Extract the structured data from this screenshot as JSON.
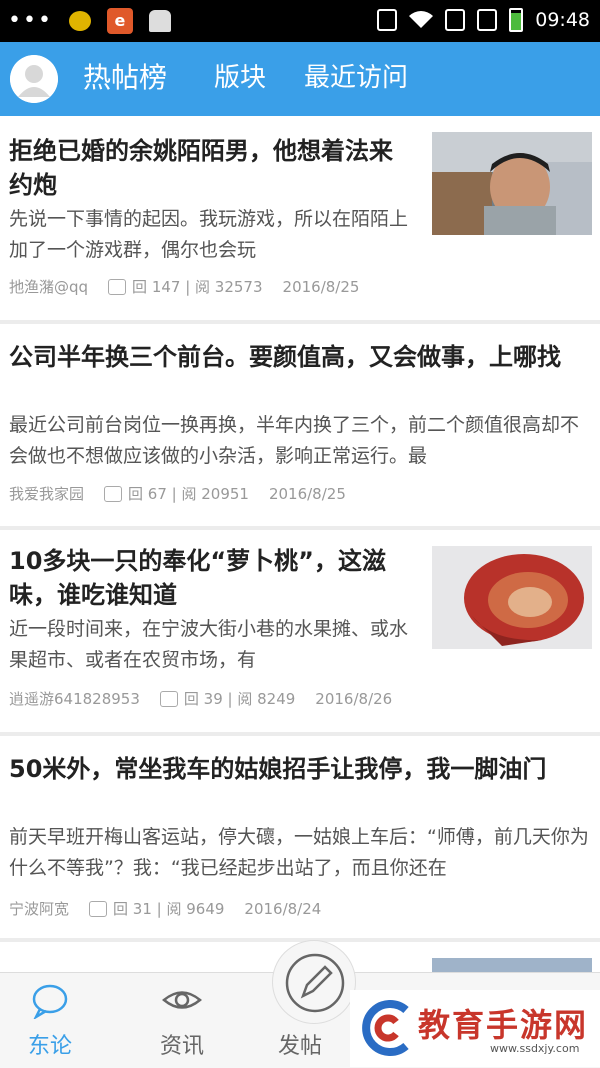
{
  "status_bar": {
    "time": "09:48"
  },
  "header": {
    "tabs": [
      {
        "label": "热帖榜"
      },
      {
        "label": "版块"
      },
      {
        "label": "最近访问"
      }
    ],
    "background": "#3a9fe8"
  },
  "posts": [
    {
      "title": "拒绝已婚的余姚陌陌男，他想着法来约炮",
      "excerpt": "先说一下事情的起因。我玩游戏，所以在陌陌上加了一个游戏群，偶尔也会玩",
      "author": "扡渔潴@qq",
      "stats": "回 147 | 阅 32573",
      "date": "2016/8/25",
      "has_thumb": true
    },
    {
      "title": "公司半年换三个前台。要颜值高，又会做事，上哪找",
      "excerpt": "最近公司前台岗位一换再换，半年内换了三个，前二个颜值很高却不会做也不想做应该做的小杂活，影响正常运行。最",
      "author": "我爱我家园",
      "stats": "回 67 | 阅 20951",
      "date": "2016/8/25",
      "has_thumb": false
    },
    {
      "title": "10多块一只的奉化“萝卜桃”，这滋味，谁吃谁知道",
      "excerpt": "近一段时间来，在宁波大街小巷的水果摊、或水果超市、或者在农贸市场，有",
      "author": "逍遥游641828953",
      "stats": "回 39 | 阅 8249",
      "date": "2016/8/26",
      "has_thumb": true
    },
    {
      "title": "50米外，常坐我车的姑娘招手让我停，我一脚油门",
      "excerpt": "前天早班开梅山客运站，停大䃶，一姑娘上车后：“师傅，前几天你为什么不等我”？我：“我已经起步出站了，而且你还在",
      "author": "宁波阿宽",
      "stats": "回 31 | 阅 9649",
      "date": "2016/8/24",
      "has_thumb": false
    }
  ],
  "bottom_nav": [
    {
      "label": "东论",
      "icon": "chat-bubble-icon",
      "active": true
    },
    {
      "label": "资讯",
      "icon": "eye-icon",
      "active": false
    },
    {
      "label": "发帖",
      "icon": "pencil-icon",
      "active": false
    }
  ],
  "watermark": {
    "text": "教育手游网",
    "url": "www.ssdxjy.com"
  }
}
